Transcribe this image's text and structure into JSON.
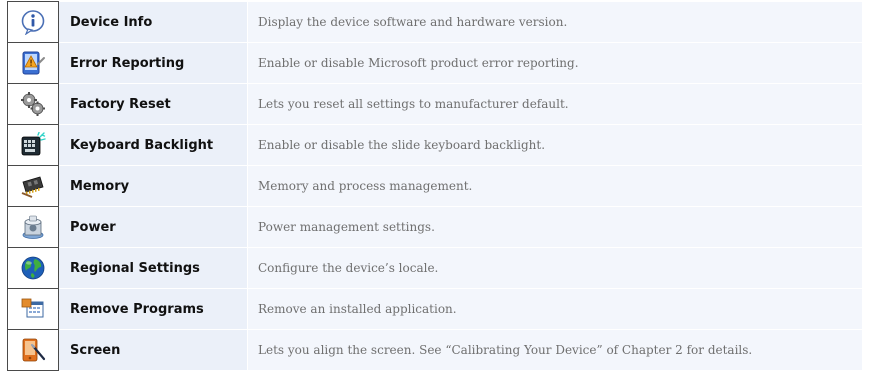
{
  "rows": [
    {
      "icon": "info-icon",
      "name": "Device Info",
      "description": "Display the device software and hardware version."
    },
    {
      "icon": "error-reporting-icon",
      "name": "Error Reporting",
      "description": "Enable or disable Microsoft product error reporting."
    },
    {
      "icon": "gears-icon",
      "name": "Factory Reset",
      "description": "Lets you reset all settings to manufacturer default."
    },
    {
      "icon": "keyboard-backlight-icon",
      "name": "Keyboard Backlight",
      "description": "Enable or disable the slide keyboard backlight."
    },
    {
      "icon": "memory-chip-icon",
      "name": "Memory",
      "description": "Memory and process management."
    },
    {
      "icon": "power-icon",
      "name": "Power",
      "description": "Power management settings."
    },
    {
      "icon": "globe-icon",
      "name": "Regional Settings",
      "description": "Configure the device’s locale."
    },
    {
      "icon": "remove-programs-icon",
      "name": "Remove Programs",
      "description": "Remove an installed application."
    },
    {
      "icon": "screen-stylus-icon",
      "name": "Screen",
      "description": "Lets you align the screen. See “Calibrating Your Device” of Chapter 2 for details."
    }
  ]
}
